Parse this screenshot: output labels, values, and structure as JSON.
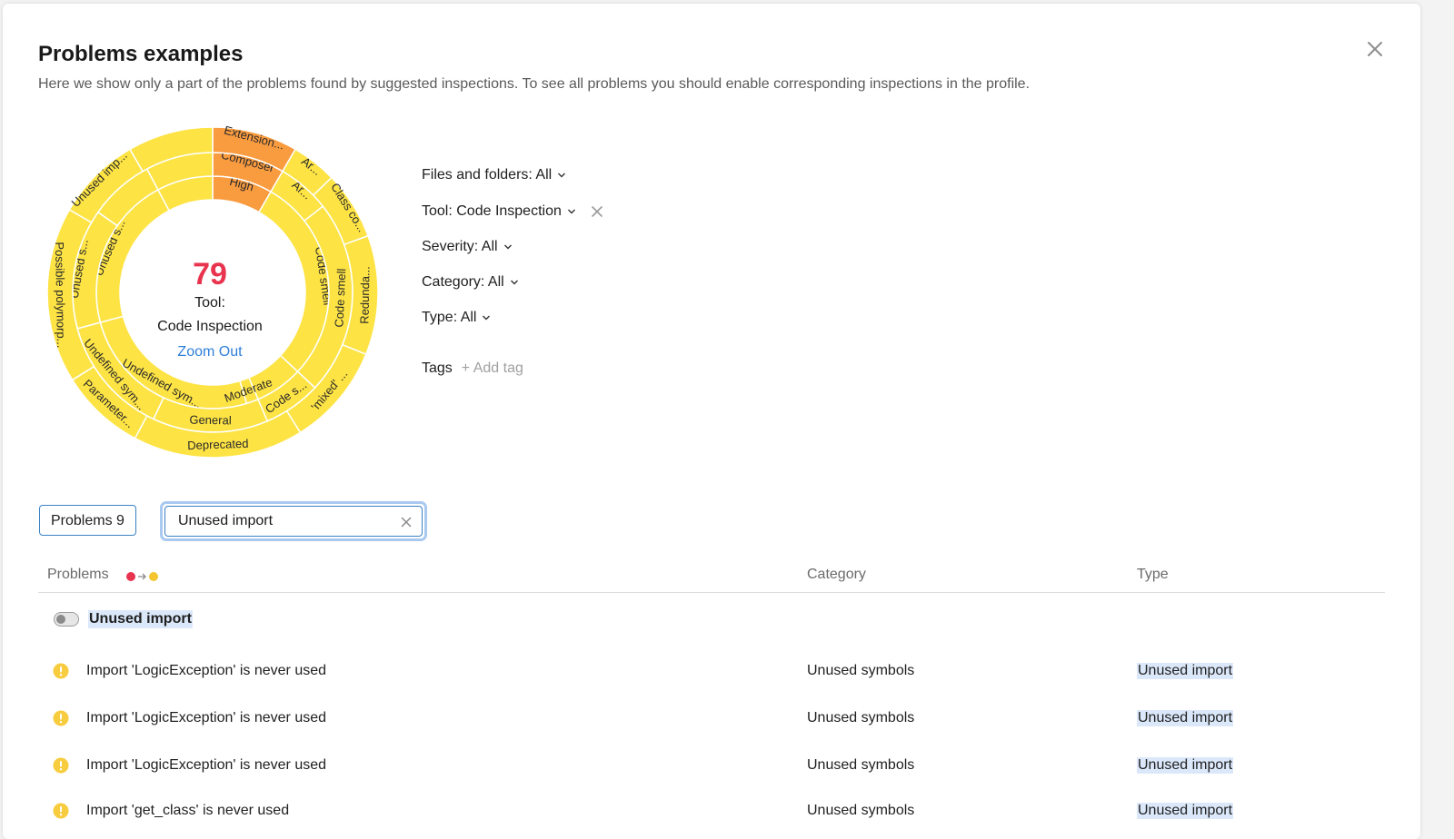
{
  "dialog": {
    "title": "Problems examples",
    "subtitle": "Here we show only a part of the problems found by suggested inspections. To see all problems you should enable corresponding inspections in the profile."
  },
  "sunburst": {
    "count": "79",
    "center_line1": "Tool:",
    "center_line2": "Code Inspection",
    "zoom_out": "Zoom Out",
    "count_color": "#e8344e",
    "zoom_color": "#2f7fd8",
    "segment_colors": {
      "normal": "#fde344",
      "highlight": "#f99b3f"
    },
    "inner_ring": [
      {
        "label": "High",
        "highlight": true
      },
      {
        "label": "Code smell",
        "highlight": false
      },
      {
        "label": "",
        "highlight": false
      },
      {
        "label": "Moderate",
        "highlight": false
      },
      {
        "label": "Undefined sym...",
        "highlight": false
      },
      {
        "label": "Unused s...",
        "highlight": false
      }
    ],
    "middle_ring": [
      {
        "label": "Composer",
        "highlight": true
      },
      {
        "label": "Ar...",
        "highlight": false
      },
      {
        "label": "Code smell",
        "highlight": false
      },
      {
        "label": "Code s...",
        "highlight": false
      },
      {
        "label": "General",
        "highlight": false
      },
      {
        "label": "Undefined sym...",
        "highlight": false
      },
      {
        "label": "Unused s...",
        "highlight": false
      }
    ],
    "outer_ring": [
      {
        "label": "Extension...",
        "highlight": true
      },
      {
        "label": "Ar...",
        "highlight": false
      },
      {
        "label": "Class co...",
        "highlight": false
      },
      {
        "label": "Redunda...",
        "highlight": false
      },
      {
        "label": "'mixed' ...",
        "highlight": false
      },
      {
        "label": "Deprecated",
        "highlight": false
      },
      {
        "label": "Parameter...",
        "highlight": false
      },
      {
        "label": "Possible polymorp...",
        "highlight": false
      },
      {
        "label": "Unused imp...",
        "highlight": false
      }
    ]
  },
  "filters": {
    "files": "Files and folders: All",
    "tool": "Tool: Code Inspection",
    "severity": "Severity: All",
    "category": "Category: All",
    "type": "Type: All",
    "tags_label": "Tags",
    "add_tag": "+ Add tag"
  },
  "toolbar": {
    "problems_button": "Problems 9",
    "search_value": "Unused import"
  },
  "table": {
    "headers": {
      "problems": "Problems",
      "category": "Category",
      "type": "Type"
    },
    "sort_colors": {
      "from": "#e8344e",
      "to": "#f5c531"
    },
    "group_label": "Unused import",
    "rows": [
      {
        "desc": "Import 'LogicException' is never used",
        "category": "Unused symbols",
        "type": "Unused import"
      },
      {
        "desc": "Import 'LogicException' is never used",
        "category": "Unused symbols",
        "type": "Unused import"
      },
      {
        "desc": "Import 'LogicException' is never used",
        "category": "Unused symbols",
        "type": "Unused import"
      },
      {
        "desc": "Import 'get_class' is never used",
        "category": "Unused symbols",
        "type": "Unused import"
      }
    ]
  }
}
